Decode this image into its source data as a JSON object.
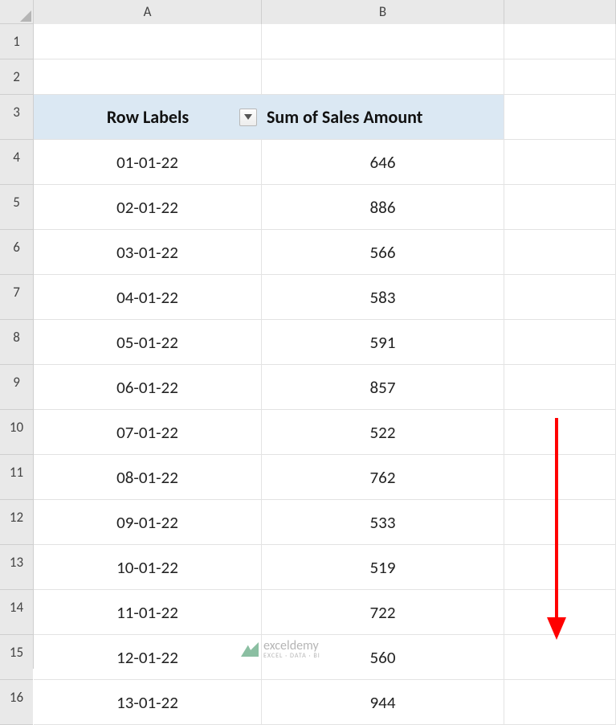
{
  "columns": [
    "A",
    "B"
  ],
  "row_numbers": [
    1,
    2,
    3,
    4,
    5,
    6,
    7,
    8,
    9,
    10,
    11,
    12,
    13,
    14,
    15,
    16
  ],
  "pivot": {
    "header_a": "Row Labels",
    "header_b": "Sum of Sales Amount",
    "rows": [
      {
        "label": "01-01-22",
        "value": "646"
      },
      {
        "label": "02-01-22",
        "value": "886"
      },
      {
        "label": "03-01-22",
        "value": "566"
      },
      {
        "label": "04-01-22",
        "value": "583"
      },
      {
        "label": "05-01-22",
        "value": "591"
      },
      {
        "label": "06-01-22",
        "value": "857"
      },
      {
        "label": "07-01-22",
        "value": "522"
      },
      {
        "label": "08-01-22",
        "value": "762"
      },
      {
        "label": "09-01-22",
        "value": "533"
      },
      {
        "label": "10-01-22",
        "value": "519"
      },
      {
        "label": "11-01-22",
        "value": "722"
      },
      {
        "label": "12-01-22",
        "value": "560"
      },
      {
        "label": "13-01-22",
        "value": "944"
      }
    ]
  },
  "watermark": {
    "brand": "exceldemy",
    "tagline": "EXCEL · DATA · BI"
  }
}
